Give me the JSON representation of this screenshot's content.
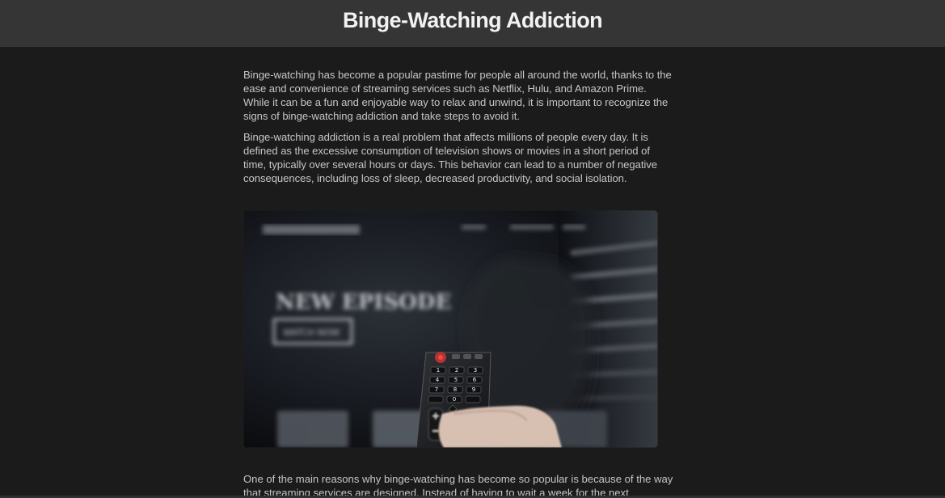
{
  "header": {
    "title": "Binge-Watching Addiction"
  },
  "paragraphs": [
    "Binge-watching has become a popular pastime for people all around the world, thanks to the ease and convenience of streaming services such as Netflix, Hulu, and Amazon Prime. While it can be a fun and enjoyable way to relax and unwind, it is important to recognize the signs of binge-watching addiction and take steps to avoid it.",
    "Binge-watching addiction is a real problem that affects millions of people every day. It is defined as the excessive consumption of television shows or movies in a short period of time, typically over several hours or days. This behavior can lead to a number of negative consequences, including loss of sleep, decreased productivity, and social isolation."
  ],
  "image": {
    "tv_brand_text": "VIDEO ON DEMAND",
    "headline": "NEW EPISODE",
    "cta": "WATCH NOW"
  },
  "lower_text": "One of the main reasons why binge-watching has become so popular is because of the way that streaming services are designed. Instead of having to wait a week for the next",
  "colors": {
    "page_bg": "#1b1b1b",
    "header_bg": "#353535",
    "text": "#c6c6c6",
    "title": "#f2f2f2"
  }
}
